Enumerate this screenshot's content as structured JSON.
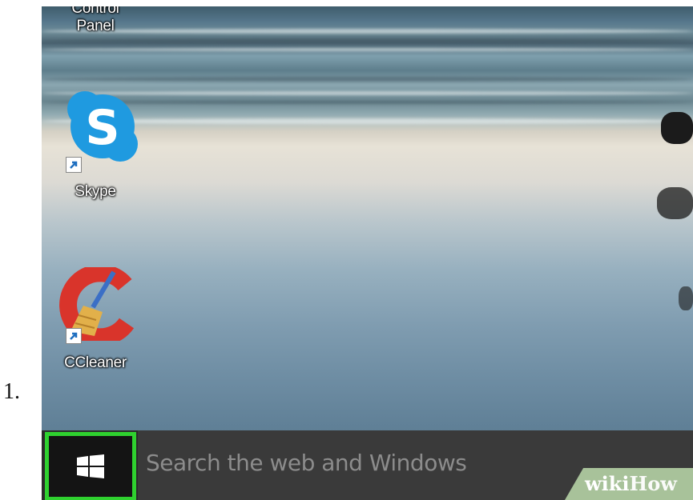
{
  "step": {
    "number": "1."
  },
  "desktop": {
    "icons": [
      {
        "label": "Control Panel",
        "icon": "control-panel-icon"
      },
      {
        "label": "Skype",
        "icon": "skype-icon",
        "shortcut": true
      },
      {
        "label": "CCleaner",
        "icon": "ccleaner-icon",
        "shortcut": true
      }
    ]
  },
  "taskbar": {
    "start_button": {
      "icon": "windows-logo-icon",
      "highlight_color": "#2fd12f"
    },
    "search": {
      "placeholder": "Search the web and Windows"
    }
  },
  "watermark": {
    "part1": "wiki",
    "part2": "How"
  },
  "colors": {
    "highlight": "#2fd12f",
    "taskbar": "#2b2b2b",
    "skype": "#1f9ae0",
    "ccleaner": "#d9342b"
  }
}
